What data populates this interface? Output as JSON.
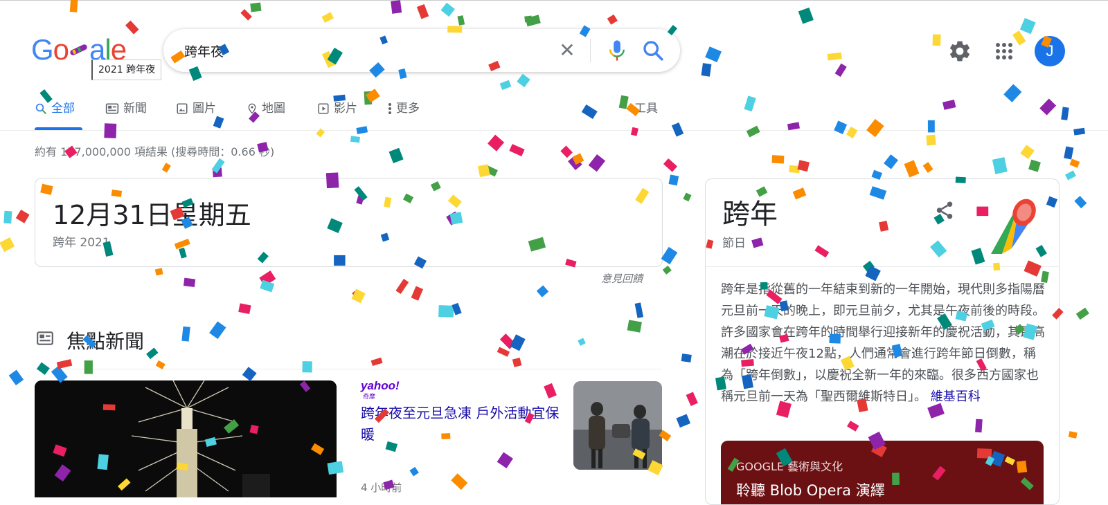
{
  "search": {
    "query": "跨年夜"
  },
  "logo": {
    "tooltip": "2021 跨年夜",
    "letters": [
      "G",
      "o",
      "",
      "a",
      "l",
      "e"
    ]
  },
  "header": {
    "avatar_letter": "J"
  },
  "tabs": [
    {
      "label": "全部",
      "icon": "search-icon",
      "active": true
    },
    {
      "label": "新聞",
      "icon": "news-icon"
    },
    {
      "label": "圖片",
      "icon": "image-icon"
    },
    {
      "label": "地圖",
      "icon": "map-pin-icon"
    },
    {
      "label": "影片",
      "icon": "video-icon"
    },
    {
      "label": "更多",
      "icon": "more-vert-icon"
    }
  ],
  "tools_label": "工具",
  "result_stats": "約有 177,000,000 項結果 (搜尋時間：0.66 秒)",
  "date_card": {
    "main": "12月31日星期五",
    "sub": "跨年 2021"
  },
  "feedback_label": "意見回饋",
  "top_stories": {
    "title": "焦點新聞",
    "items": [
      {
        "source": "yahoo!",
        "source_sub": "奇摩",
        "headline": "跨年夜至元旦急凍 戶外活動宜保暖",
        "time": "4 小時前"
      }
    ]
  },
  "knowledge_panel": {
    "title": "跨年",
    "subtitle": "節日",
    "description": "跨年是指從舊的一年結束到新的一年開始，現代則多指陽曆元旦前一天的晚上，即元旦前夕，尤其是午夜前後的時段。許多國家會在跨年的時間舉行迎接新年的慶祝活動，其最高潮在於接近午夜12點，人們通常會進行跨年節日倒數，稱為「跨年倒數」，以慶祝全新一年的來臨。很多西方國家也稱元旦前一天為「聖西爾維斯特日」。",
    "source_link": "維基百科",
    "arts": {
      "label": "GOOGLE 藝術與文化",
      "title": "聆聽 Blob Opera 演繹"
    }
  },
  "colors": {
    "accent": "#1a73e8",
    "link": "#1a0dab",
    "confetti": [
      "#e53935",
      "#1e88e5",
      "#43a047",
      "#fb8c00",
      "#8e24aa",
      "#fdd835",
      "#4dd0e1",
      "#e91e63",
      "#00897b",
      "#1565c0"
    ]
  }
}
